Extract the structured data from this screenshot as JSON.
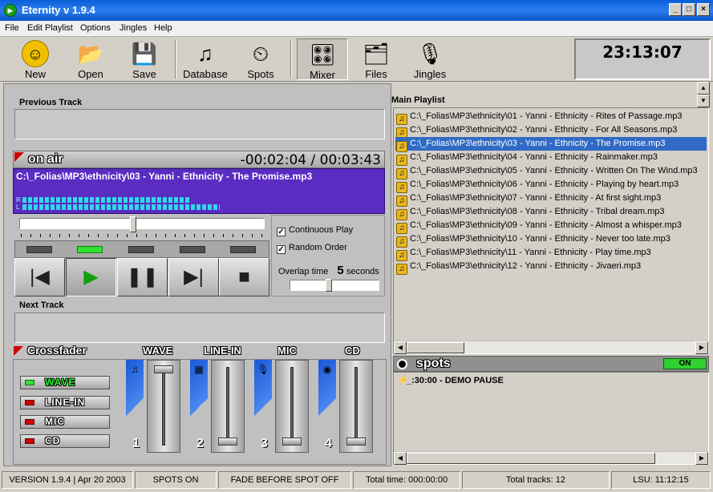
{
  "window": {
    "title": "Eternity v 1.9.4",
    "minimize": "_",
    "maximize": "□",
    "close": "×"
  },
  "menu": [
    "File",
    "Edit Playlist",
    "Options",
    "Jingles",
    "Help"
  ],
  "toolbar": {
    "new": "New",
    "open": "Open",
    "save": "Save",
    "database": "Database",
    "spots": "Spots",
    "mixer": "Mixer",
    "files": "Files",
    "jingles": "Jingles"
  },
  "clock": "23:13:07",
  "previous_track": {
    "label": "Previous Track",
    "value": ""
  },
  "on_air": {
    "label": "on air",
    "time": "-00:02:04 / 00:03:43",
    "track": "C:\\_Folias\\MP3\\ethnicity\\03 - Yanni - Ethnicity - The Promise.mp3",
    "vu_r": "R",
    "vu_l": "L",
    "vu_levels": {
      "r": 0.7,
      "l": 0.82
    },
    "seek_position": 0.46
  },
  "transport": {
    "prev": "|◀",
    "play": "▶",
    "pause": "❚❚",
    "next": "▶|",
    "stop": "■"
  },
  "options": {
    "continuous_play": "Continuous Play",
    "continuous_checked": "✓",
    "random_order": "Random Order",
    "random_checked": "✓",
    "overlap_label": "Overlap time",
    "overlap_value": "5",
    "overlap_unit": "seconds"
  },
  "next_track": {
    "label": "Next Track",
    "value": ""
  },
  "crossfader": {
    "label": "Crossfader",
    "channels": [
      "WAVE",
      "LINE-IN",
      "MIC",
      "CD"
    ],
    "sources": [
      "WAVE",
      "LINE-IN",
      "MIC",
      "CD"
    ],
    "fader_numbers": [
      "1",
      "2",
      "3",
      "4"
    ],
    "fader_levels": [
      0.0,
      1.0,
      1.0,
      1.0
    ]
  },
  "playlist": {
    "label": "Main Playlist",
    "items": [
      "C:\\_Folias\\MP3\\ethnicity\\01 - Yanni - Ethnicity - Rites of Passage.mp3",
      "C:\\_Folias\\MP3\\ethnicity\\02 - Yanni - Ethnicity - For All Seasons.mp3",
      "C:\\_Folias\\MP3\\ethnicity\\03 - Yanni - Ethnicity - The Promise.mp3",
      "C:\\_Folias\\MP3\\ethnicity\\04 - Yanni - Ethnicity - Rainmaker.mp3",
      "C:\\_Folias\\MP3\\ethnicity\\05 - Yanni - Ethnicity - Written On The Wind.mp3",
      "C:\\_Folias\\MP3\\ethnicity\\06 - Yanni - Ethnicity - Playing by heart.mp3",
      "C:\\_Folias\\MP3\\ethnicity\\07 - Yanni - Ethnicity - At first sight.mp3",
      "C:\\_Folias\\MP3\\ethnicity\\08 - Yanni - Ethnicity - Tribal dream.mp3",
      "C:\\_Folias\\MP3\\ethnicity\\09 - Yanni - Ethnicity - Almost a whisper.mp3",
      "C:\\_Folias\\MP3\\ethnicity\\10 - Yanni - Ethnicity - Never too late.mp3",
      "C:\\_Folias\\MP3\\ethnicity\\11 - Yanni - Ethnicity - Play time.mp3",
      "C:\\_Folias\\MP3\\ethnicity\\12 - Yanni - Ethnicity - Jivaeri.mp3"
    ],
    "selected_index": 2
  },
  "spots": {
    "label": "spots",
    "status": "ON",
    "items": [
      "_:30:00 - DEMO PAUSE"
    ]
  },
  "status": {
    "version": "VERSION 1.9.4 | Apr  20 2003",
    "spots": "SPOTS ON",
    "fade": "FADE BEFORE SPOT OFF",
    "total_time": "Total time: 000:00:00",
    "total_tracks": "Total tracks: 12",
    "lsu": "LSU: 11:12:15"
  }
}
